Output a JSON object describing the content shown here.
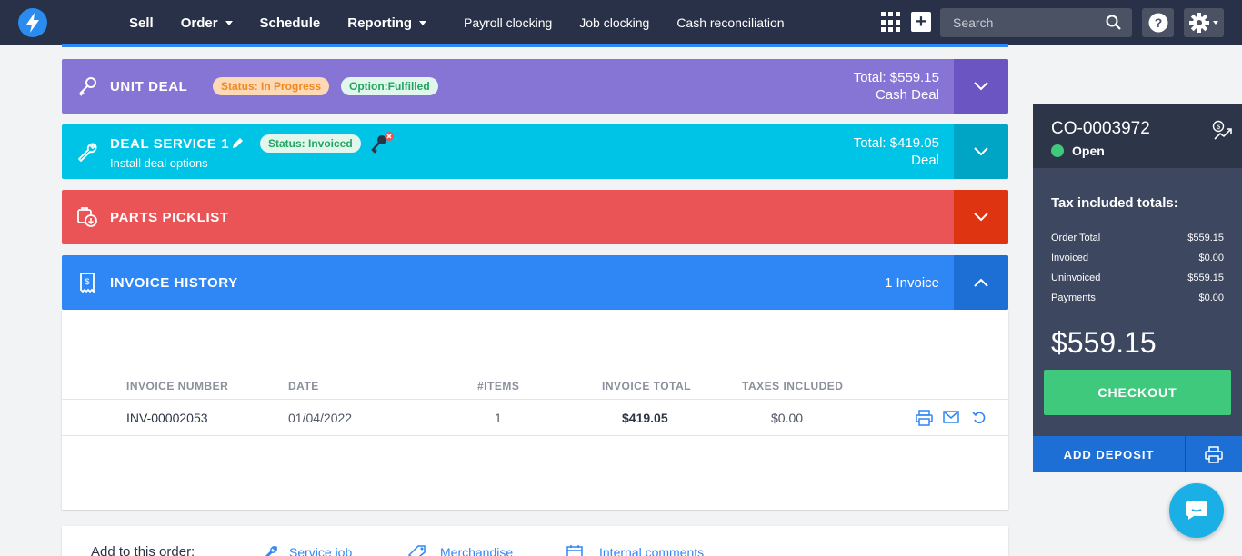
{
  "nav": {
    "main": [
      {
        "label": "Sell",
        "dropdown": false
      },
      {
        "label": "Order",
        "dropdown": true
      },
      {
        "label": "Schedule",
        "dropdown": false
      },
      {
        "label": "Reporting",
        "dropdown": true
      }
    ],
    "sub": [
      "Payroll clocking",
      "Job clocking",
      "Cash reconciliation"
    ],
    "search_placeholder": "Search"
  },
  "unit_deal": {
    "title": "UNIT DEAL",
    "status_badge": "Status: In Progress",
    "option_badge": "Option:Fulfilled",
    "total": "Total: $559.15",
    "type": "Cash Deal"
  },
  "deal_service": {
    "title": "DEAL SERVICE 1",
    "subtitle": "Install deal options",
    "status_badge": "Status: Invoiced",
    "total": "Total: $419.05",
    "type": "Deal"
  },
  "parts_picklist": {
    "title": "PARTS PICKLIST"
  },
  "invoice_history": {
    "title": "INVOICE HISTORY",
    "count": "1 Invoice",
    "columns": [
      "INVOICE NUMBER",
      "DATE",
      "#ITEMS",
      "INVOICE TOTAL",
      "TAXES INCLUDED"
    ],
    "rows": [
      {
        "number": "INV-00002053",
        "date": "01/04/2022",
        "items": "1",
        "total": "$419.05",
        "taxes": "$0.00"
      }
    ]
  },
  "add_to_order": {
    "label": "Add to this order:",
    "links": [
      "Service job",
      "Merchandise",
      "Internal comments"
    ]
  },
  "sidebar": {
    "order_id": "CO-0003972",
    "status": "Open",
    "tax_title": "Tax included totals:",
    "totals": [
      {
        "label": "Order Total",
        "value": "$559.15"
      },
      {
        "label": "Invoiced",
        "value": "$0.00"
      },
      {
        "label": "Uninvoiced",
        "value": "$559.15"
      },
      {
        "label": "Payments",
        "value": "$0.00"
      }
    ],
    "balance": "$559.15",
    "checkout_label": "CHECKOUT",
    "deposit_label": "ADD DEPOSIT"
  },
  "colors": {
    "nav": "#283147",
    "unit_deal": "#8775d6",
    "deal_service": "#00c4e6",
    "parts_picklist": "#ea5456",
    "invoice_history": "#2e87f5",
    "checkout": "#3ec97d"
  }
}
